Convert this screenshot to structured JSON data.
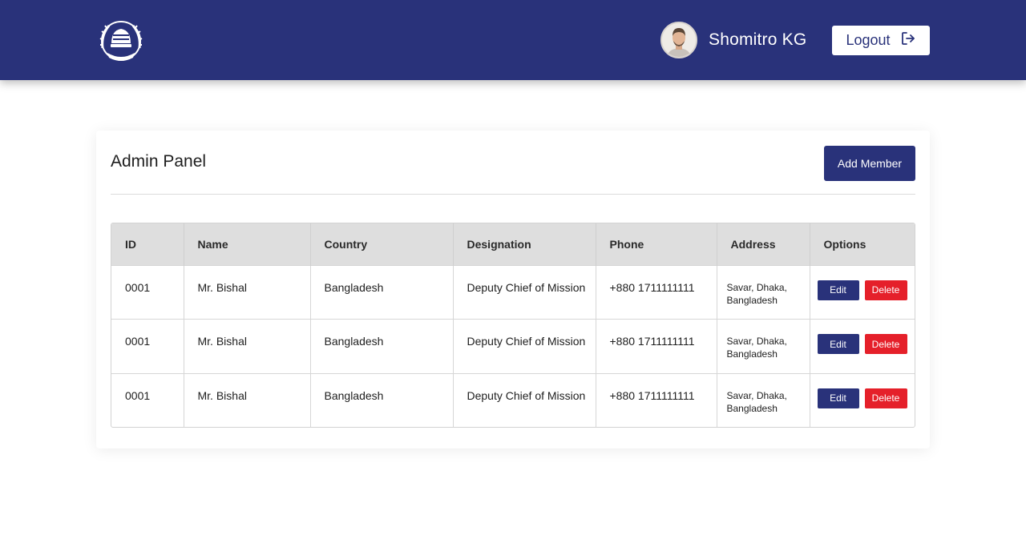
{
  "header": {
    "user_name": "Shomitro KG",
    "logout_label": "Logout",
    "colors": {
      "primary": "#29327a",
      "danger": "#e5202a"
    }
  },
  "panel": {
    "title": "Admin Panel",
    "add_button_label": "Add Member"
  },
  "table": {
    "columns": [
      "ID",
      "Name",
      "Country",
      "Designation",
      "Phone",
      "Address",
      "Options"
    ],
    "rows": [
      {
        "id": "0001",
        "name": "Mr. Bishal",
        "country": "Bangladesh",
        "designation": "Deputy Chief of Mission",
        "phone": "+880 1711111111",
        "address_line1": "Savar, Dhaka,",
        "address_line2": "Bangladesh",
        "edit_label": "Edit",
        "delete_label": "Delete"
      },
      {
        "id": "0001",
        "name": "Mr. Bishal",
        "country": "Bangladesh",
        "designation": "Deputy Chief of Mission",
        "phone": "+880 1711111111",
        "address_line1": "Savar, Dhaka,",
        "address_line2": "Bangladesh",
        "edit_label": "Edit",
        "delete_label": "Delete"
      },
      {
        "id": "0001",
        "name": "Mr. Bishal",
        "country": "Bangladesh",
        "designation": "Deputy Chief of Mission",
        "phone": "+880 1711111111",
        "address_line1": "Savar, Dhaka,",
        "address_line2": "Bangladesh",
        "edit_label": "Edit",
        "delete_label": "Delete"
      }
    ]
  },
  "icons": {
    "logo": "police-emblem-icon",
    "avatar": "user-avatar",
    "logout": "logout-icon"
  }
}
